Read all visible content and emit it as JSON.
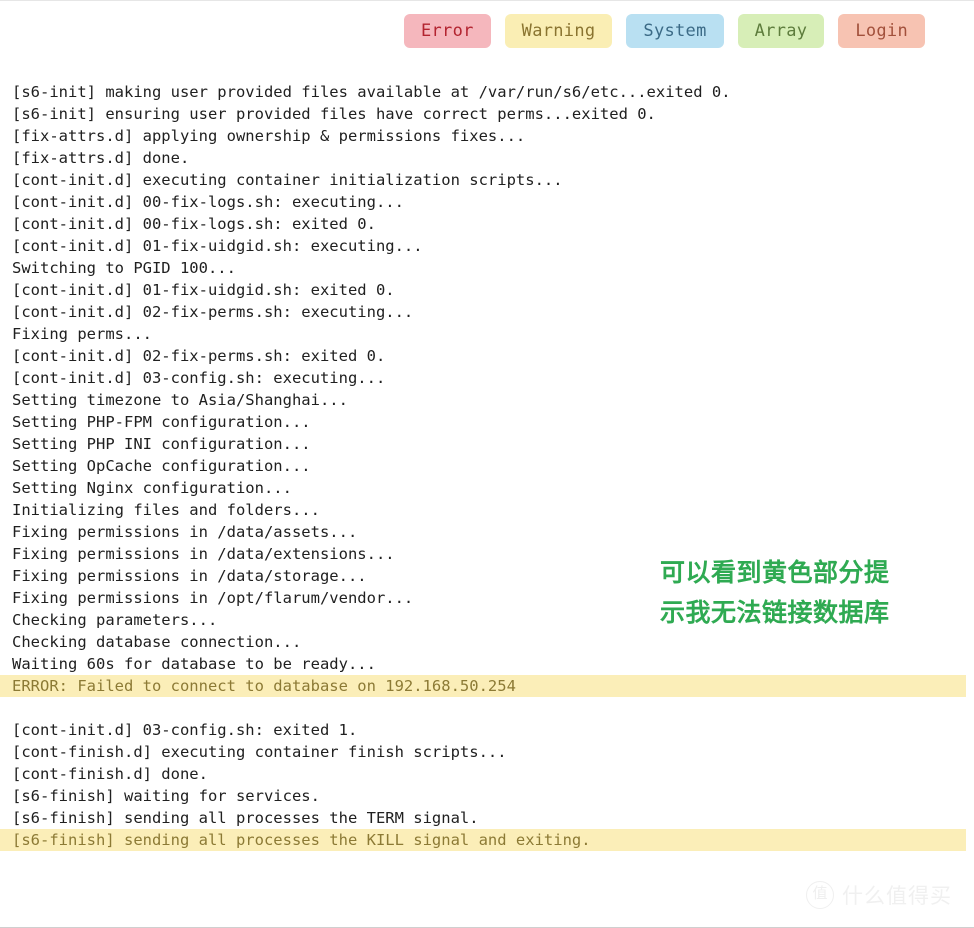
{
  "filters": [
    {
      "id": "error",
      "label": "Error"
    },
    {
      "id": "warning",
      "label": "Warning"
    },
    {
      "id": "system",
      "label": "System"
    },
    {
      "id": "array",
      "label": "Array"
    },
    {
      "id": "login",
      "label": "Login"
    }
  ],
  "colors": {
    "error_bg": "#f5b7bd",
    "error_fg": "#b32430",
    "warning_bg": "#faeeb4",
    "warning_fg": "#8a7430",
    "system_bg": "#b9e0f2",
    "system_fg": "#3b6a86",
    "array_bg": "#d7eeb7",
    "array_fg": "#5d7c3c",
    "login_bg": "#f7c3b2",
    "login_fg": "#a2503b",
    "highlight_bg": "#fbeeb8",
    "highlight_fg": "#8c7a35",
    "log_fg": "#202020",
    "annotation_fg": "#2faa52",
    "page_bg": "#ffffff"
  },
  "log": {
    "lines": [
      {
        "text": "[s6-init] making user provided files available at /var/run/s6/etc...exited 0.",
        "highlight": false
      },
      {
        "text": "[s6-init] ensuring user provided files have correct perms...exited 0.",
        "highlight": false
      },
      {
        "text": "[fix-attrs.d] applying ownership & permissions fixes...",
        "highlight": false
      },
      {
        "text": "[fix-attrs.d] done.",
        "highlight": false
      },
      {
        "text": "[cont-init.d] executing container initialization scripts...",
        "highlight": false
      },
      {
        "text": "[cont-init.d] 00-fix-logs.sh: executing...",
        "highlight": false
      },
      {
        "text": "[cont-init.d] 00-fix-logs.sh: exited 0.",
        "highlight": false
      },
      {
        "text": "[cont-init.d] 01-fix-uidgid.sh: executing...",
        "highlight": false
      },
      {
        "text": "Switching to PGID 100...",
        "highlight": false
      },
      {
        "text": "[cont-init.d] 01-fix-uidgid.sh: exited 0.",
        "highlight": false
      },
      {
        "text": "[cont-init.d] 02-fix-perms.sh: executing...",
        "highlight": false
      },
      {
        "text": "Fixing perms...",
        "highlight": false
      },
      {
        "text": "[cont-init.d] 02-fix-perms.sh: exited 0.",
        "highlight": false
      },
      {
        "text": "[cont-init.d] 03-config.sh: executing...",
        "highlight": false
      },
      {
        "text": "Setting timezone to Asia/Shanghai...",
        "highlight": false
      },
      {
        "text": "Setting PHP-FPM configuration...",
        "highlight": false
      },
      {
        "text": "Setting PHP INI configuration...",
        "highlight": false
      },
      {
        "text": "Setting OpCache configuration...",
        "highlight": false
      },
      {
        "text": "Setting Nginx configuration...",
        "highlight": false
      },
      {
        "text": "Initializing files and folders...",
        "highlight": false
      },
      {
        "text": "Fixing permissions in /data/assets...",
        "highlight": false
      },
      {
        "text": "Fixing permissions in /data/extensions...",
        "highlight": false
      },
      {
        "text": "Fixing permissions in /data/storage...",
        "highlight": false
      },
      {
        "text": "Fixing permissions in /opt/flarum/vendor...",
        "highlight": false
      },
      {
        "text": "Checking parameters...",
        "highlight": false
      },
      {
        "text": "Checking database connection...",
        "highlight": false
      },
      {
        "text": "Waiting 60s for database to be ready...",
        "highlight": false
      },
      {
        "text": "ERROR: Failed to connect to database on 192.168.50.254",
        "highlight": true
      },
      {
        "text": "",
        "highlight": false
      },
      {
        "text": "[cont-init.d] 03-config.sh: exited 1.",
        "highlight": false
      },
      {
        "text": "[cont-finish.d] executing container finish scripts...",
        "highlight": false
      },
      {
        "text": "[cont-finish.d] done.",
        "highlight": false
      },
      {
        "text": "[s6-finish] waiting for services.",
        "highlight": false
      },
      {
        "text": "[s6-finish] sending all processes the TERM signal.",
        "highlight": false
      },
      {
        "text": "[s6-finish] sending all processes the KILL signal and exiting.",
        "highlight": true
      }
    ]
  },
  "annotation": {
    "line1": "可以看到黄色部分提",
    "line2": "示我无法链接数据库"
  },
  "watermark": {
    "badge": "值",
    "text": "什么值得买"
  }
}
